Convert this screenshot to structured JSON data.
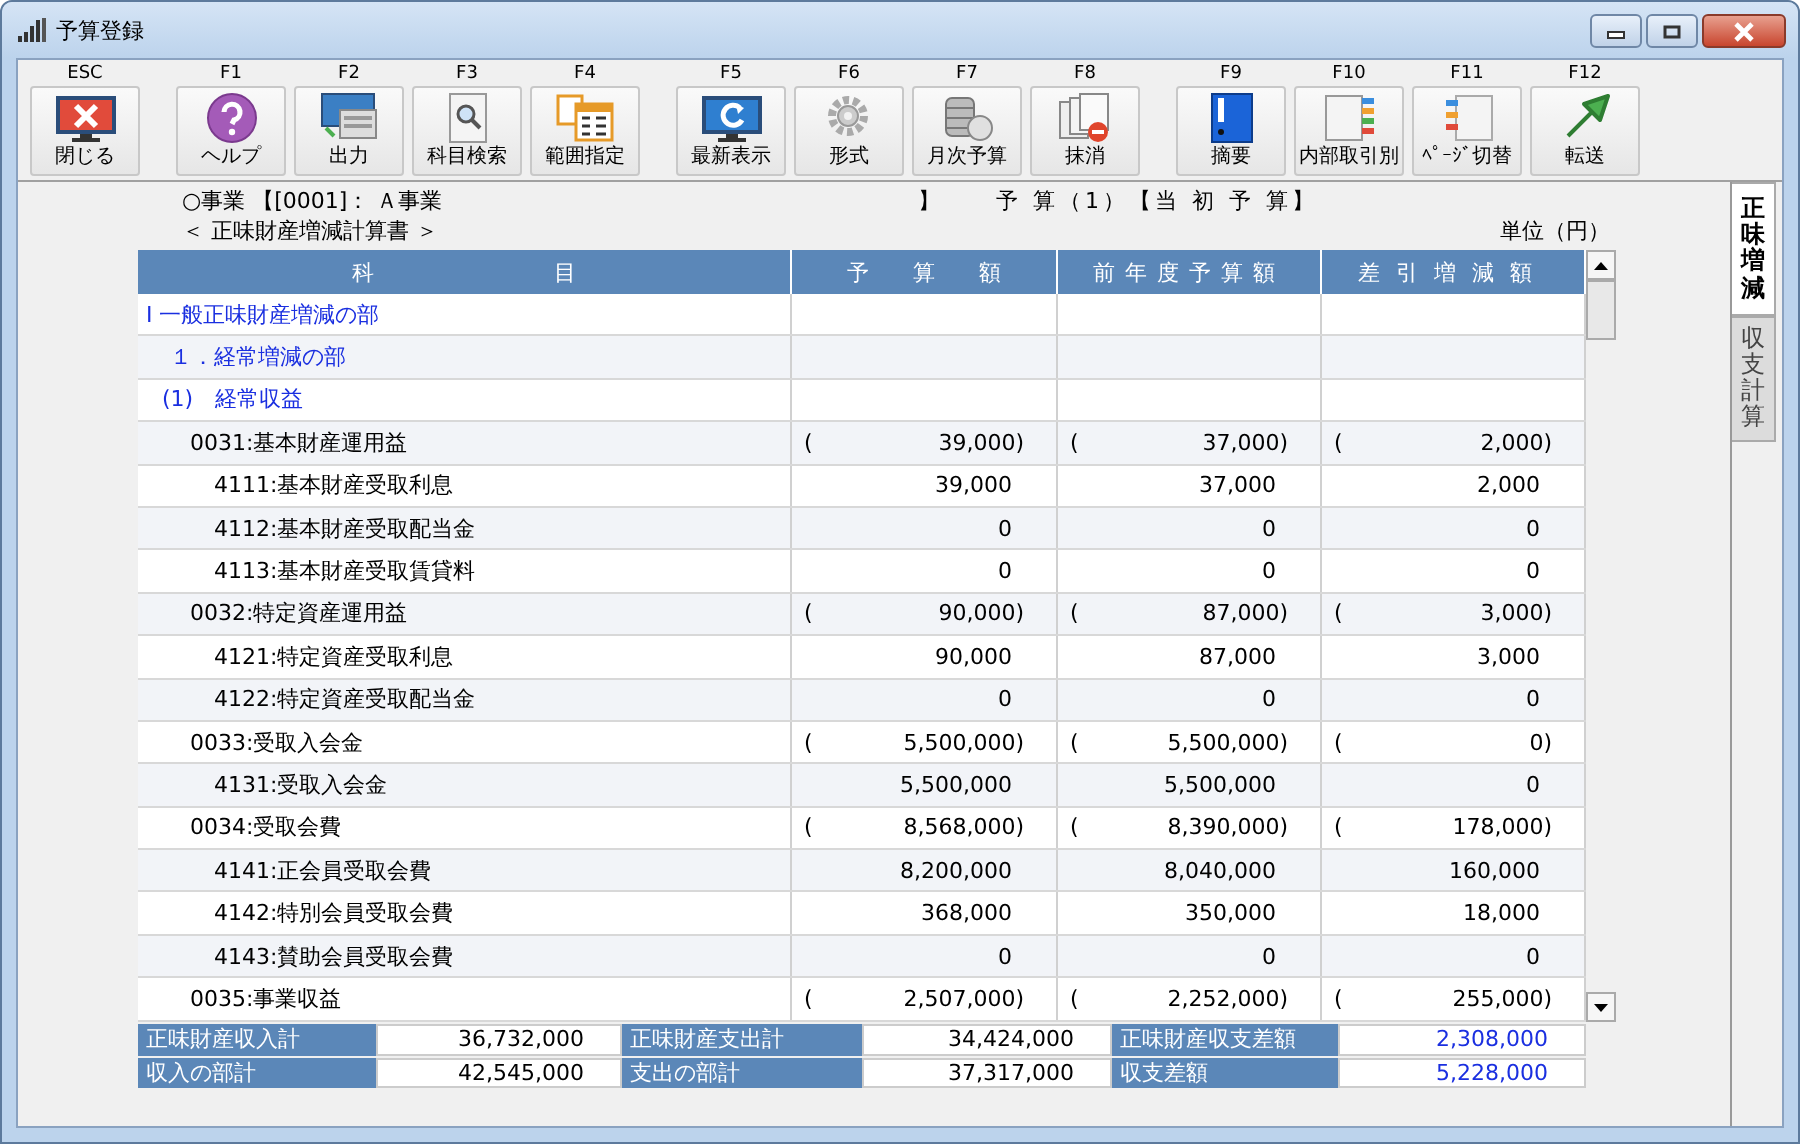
{
  "window": {
    "title": "予算登録"
  },
  "toolbar": [
    {
      "key": "ESC",
      "label": "閉じる"
    },
    {
      "key": "F1",
      "label": "ヘルプ"
    },
    {
      "key": "F2",
      "label": "出力"
    },
    {
      "key": "F3",
      "label": "科目検索"
    },
    {
      "key": "F4",
      "label": "範囲指定"
    },
    {
      "key": "F5",
      "label": "最新表示"
    },
    {
      "key": "F6",
      "label": "形式"
    },
    {
      "key": "F7",
      "label": "月次予算"
    },
    {
      "key": "F8",
      "label": "抹消"
    },
    {
      "key": "F9",
      "label": "摘要"
    },
    {
      "key": "F10",
      "label": "内部取引別"
    },
    {
      "key": "F11",
      "label": "ﾍﾟｰｼﾞ切替"
    },
    {
      "key": "F12",
      "label": "転送"
    }
  ],
  "header": {
    "business": "○事業 【[0001]： Ａ事業",
    "business_close": "】",
    "budget": "予 算（1）【当 初 予 算】",
    "statement": "＜ 正味財産増減計算書 ＞",
    "unit": "単位（円）"
  },
  "table": {
    "columns": [
      "科目",
      "予算額",
      "前年度予算額",
      "差引増減額"
    ],
    "rows": [
      {
        "kind": "part",
        "cells": [
          {
            "value": "Ⅰ 一般正味財産増減の部"
          }
        ]
      },
      {
        "kind": "subpart",
        "cells": [
          {
            "value": "１．経常増減の部"
          }
        ]
      },
      {
        "kind": "category",
        "cells": [
          {
            "value": "(1)　経常収益"
          }
        ]
      },
      {
        "kind": "group",
        "cells": [
          {
            "value": "0031:基本財産運用益"
          },
          {
            "mark": "(",
            "value": "39,000)"
          },
          {
            "mark": "(",
            "value": "37,000)"
          },
          {
            "mark": "(",
            "value": "2,000)"
          }
        ]
      },
      {
        "kind": "item",
        "cells": [
          {
            "value": "4111:基本財産受取利息"
          },
          {
            "value": "39,000"
          },
          {
            "value": "37,000"
          },
          {
            "value": "2,000"
          }
        ]
      },
      {
        "kind": "item",
        "cells": [
          {
            "value": "4112:基本財産受取配当金"
          },
          {
            "value": "0"
          },
          {
            "value": "0"
          },
          {
            "value": "0"
          }
        ]
      },
      {
        "kind": "item",
        "cells": [
          {
            "value": "4113:基本財産受取賃貸料"
          },
          {
            "value": "0"
          },
          {
            "value": "0"
          },
          {
            "value": "0"
          }
        ]
      },
      {
        "kind": "group",
        "cells": [
          {
            "value": "0032:特定資産運用益"
          },
          {
            "mark": "(",
            "value": "90,000)"
          },
          {
            "mark": "(",
            "value": "87,000)"
          },
          {
            "mark": "(",
            "value": "3,000)"
          }
        ]
      },
      {
        "kind": "item",
        "cells": [
          {
            "value": "4121:特定資産受取利息"
          },
          {
            "value": "90,000"
          },
          {
            "value": "87,000"
          },
          {
            "value": "3,000"
          }
        ]
      },
      {
        "kind": "item",
        "cells": [
          {
            "value": "4122:特定資産受取配当金"
          },
          {
            "value": "0"
          },
          {
            "value": "0"
          },
          {
            "value": "0"
          }
        ]
      },
      {
        "kind": "group",
        "cells": [
          {
            "value": "0033:受取入会金"
          },
          {
            "mark": "(",
            "value": "5,500,000)"
          },
          {
            "mark": "(",
            "value": "5,500,000)"
          },
          {
            "mark": "(",
            "value": "0)"
          }
        ]
      },
      {
        "kind": "item",
        "cells": [
          {
            "value": "4131:受取入会金"
          },
          {
            "value": "5,500,000"
          },
          {
            "value": "5,500,000"
          },
          {
            "value": "0"
          }
        ]
      },
      {
        "kind": "group",
        "cells": [
          {
            "value": "0034:受取会費"
          },
          {
            "mark": "(",
            "value": "8,568,000)"
          },
          {
            "mark": "(",
            "value": "8,390,000)"
          },
          {
            "mark": "(",
            "value": "178,000)"
          }
        ]
      },
      {
        "kind": "item",
        "cells": [
          {
            "value": "4141:正会員受取会費"
          },
          {
            "value": "8,200,000"
          },
          {
            "value": "8,040,000"
          },
          {
            "value": "160,000"
          }
        ]
      },
      {
        "kind": "item",
        "cells": [
          {
            "value": "4142:特別会員受取会費"
          },
          {
            "value": "368,000"
          },
          {
            "value": "350,000"
          },
          {
            "value": "18,000"
          }
        ]
      },
      {
        "kind": "item",
        "cells": [
          {
            "value": "4143:賛助会員受取会費"
          },
          {
            "value": "0"
          },
          {
            "value": "0"
          },
          {
            "value": "0"
          }
        ]
      },
      {
        "kind": "group",
        "cells": [
          {
            "value": "0035:事業収益"
          },
          {
            "mark": "(",
            "value": "2,507,000)"
          },
          {
            "mark": "(",
            "value": "2,252,000)"
          },
          {
            "mark": "(",
            "value": "255,000)"
          }
        ]
      }
    ]
  },
  "summary": [
    [
      {
        "label": "正味財産収入計",
        "value": "36,732,000",
        "highlight": false
      },
      {
        "label": "正味財産支出計",
        "value": "34,424,000",
        "highlight": false
      },
      {
        "label": "正味財産収支差額",
        "value": "2,308,000",
        "highlight": true
      }
    ],
    [
      {
        "label": "収入の部計",
        "value": "42,545,000",
        "highlight": false
      },
      {
        "label": "支出の部計",
        "value": "37,317,000",
        "highlight": false
      },
      {
        "label": "収支差額",
        "value": "5,228,000",
        "highlight": true
      }
    ]
  ],
  "side_tabs": [
    {
      "label": "正味増減",
      "selected": true
    },
    {
      "label": "収支計算",
      "selected": false
    }
  ]
}
